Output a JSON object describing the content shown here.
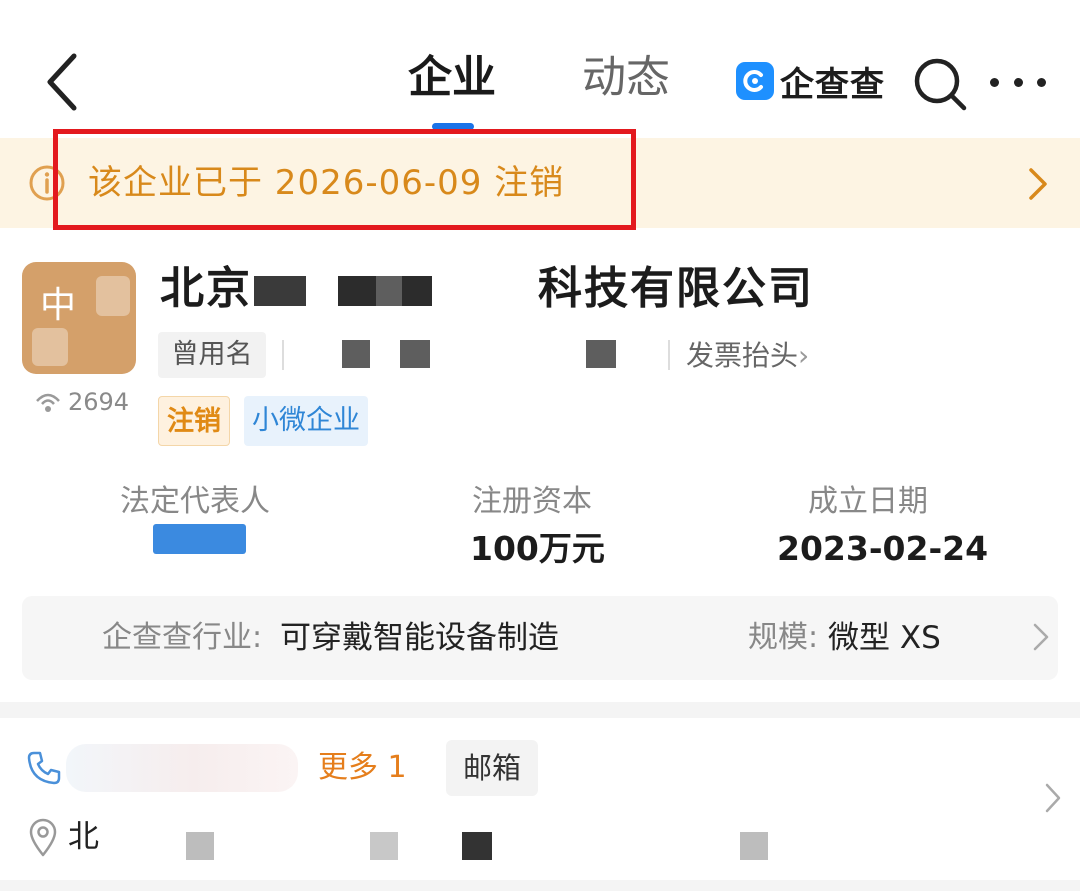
{
  "nav": {
    "tab_company": "企业",
    "tab_dynamic": "动态",
    "brand_name": "企查查"
  },
  "notice": {
    "text": "该企业已于 2026-06-09 注销",
    "highlight_color": "#e3191e"
  },
  "company": {
    "logo_char": "中",
    "name_prefix": "北京",
    "name_suffix": "科技有限公司",
    "heat_count": "2694",
    "former_name_label": "曾用名",
    "invoice_label": "发票抬头",
    "tags": [
      "注销",
      "小微企业"
    ]
  },
  "stats": {
    "legal_rep_label": "法定代表人",
    "capital_label": "注册资本",
    "capital_value": "100万元",
    "founded_label": "成立日期",
    "founded_value": "2023-02-24"
  },
  "industry": {
    "label": "企查查行业:",
    "value": "可穿戴智能设备制造",
    "scale_label": "规模:",
    "scale_value": "微型 XS"
  },
  "contact": {
    "more_phone": "更多 1",
    "email_label": "邮箱",
    "address_prefix": "北"
  },
  "icons": [
    "back-icon",
    "search-icon",
    "more-icon",
    "info-icon",
    "chevron-right-icon",
    "heat-icon",
    "phone-icon",
    "location-icon"
  ],
  "colors": {
    "accent_blue": "#1a73e8",
    "notice_orange": "#d8891b",
    "notice_bg": "#fdf4e3"
  }
}
